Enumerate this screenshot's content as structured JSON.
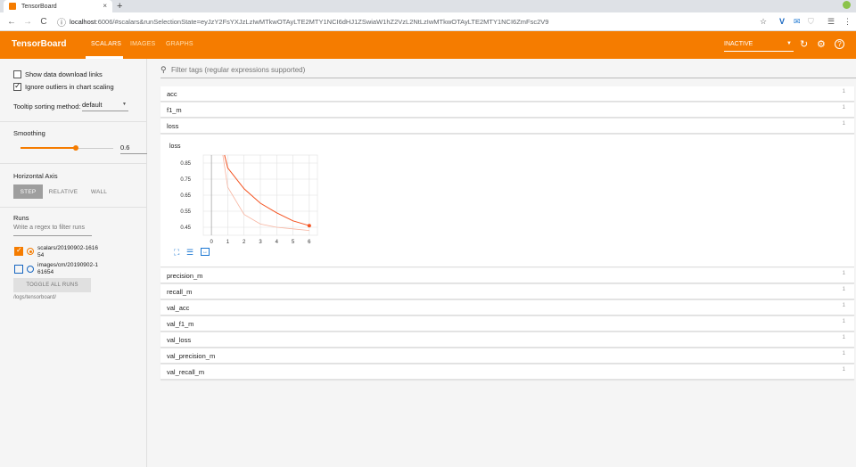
{
  "browser": {
    "tab_title": "TensorBoard",
    "tab_close": "×",
    "new_tab": "+",
    "url_host": "localhost",
    "url_rest": ":6006/#scalars&runSelectionState=eyJzY2FsYXJzLzIwMTkwOTAyLTE2MTY1NCI6dHJ1ZSwiaW1hZ2VzL2NtLzIwMTkwOTAyLTE2MTY1NCI6ZmFsc2V9",
    "back": "←",
    "forward": "→",
    "reload": "C",
    "info": "ⓘ",
    "star": "☆",
    "menu": "⋮"
  },
  "appbar": {
    "brand": "TensorBoard",
    "tabs": [
      {
        "label": "SCALARS",
        "active": true
      },
      {
        "label": "IMAGES",
        "active": false
      },
      {
        "label": "GRAPHS",
        "active": false
      }
    ],
    "status_select": "INACTIVE",
    "reload_icon": "↻",
    "settings_icon": "⚙",
    "help_icon": "?"
  },
  "sidebar": {
    "show_download": "Show data download links",
    "ignore_outliers": "Ignore outliers in chart scaling",
    "tooltip_label": "Tooltip sorting method:",
    "tooltip_value": "default",
    "smoothing_label": "Smoothing",
    "smoothing_value": "0.6",
    "smoothing_fraction": 0.6,
    "horizontal_axis_label": "Horizontal Axis",
    "axis_buttons": [
      "STEP",
      "RELATIVE",
      "WALL"
    ],
    "runs_label": "Runs",
    "regex_placeholder": "Write a regex to filter runs",
    "runs": [
      {
        "label": "scalars/20190902-161654",
        "checked": true,
        "color": "#f57c00"
      },
      {
        "label": "images/cm/20190902-161654",
        "checked": false,
        "color": "#1565c0"
      }
    ],
    "toggle_all": "TOGGLE ALL RUNS",
    "logdir": "/logs/tensorboard/"
  },
  "main": {
    "filter_placeholder": "Filter tags (regular expressions supported)",
    "tags_top": [
      {
        "name": "acc",
        "count": "1"
      },
      {
        "name": "f1_m",
        "count": "1"
      },
      {
        "name": "loss",
        "count": "1"
      }
    ],
    "tags_bottom": [
      {
        "name": "precision_m",
        "count": "1"
      },
      {
        "name": "recall_m",
        "count": "1"
      },
      {
        "name": "val_acc",
        "count": "1"
      },
      {
        "name": "val_f1_m",
        "count": "1"
      },
      {
        "name": "val_loss",
        "count": "1"
      },
      {
        "name": "val_precision_m",
        "count": "1"
      },
      {
        "name": "val_recall_m",
        "count": "1"
      }
    ]
  },
  "chart_data": {
    "type": "line",
    "title": "loss",
    "x_ticks": [
      0,
      1,
      2,
      3,
      4,
      5,
      6
    ],
    "y_ticks": [
      0.45,
      0.55,
      0.65,
      0.75,
      0.85
    ],
    "xlim": [
      -0.5,
      6.5
    ],
    "ylim": [
      0.4,
      0.9
    ],
    "series": [
      {
        "color": "#f4511e",
        "x": [
          0.8,
          1,
          2,
          3,
          4,
          5,
          6
        ],
        "y": [
          0.9,
          0.82,
          0.69,
          0.6,
          0.54,
          0.49,
          0.46
        ]
      },
      {
        "color": "#f7b4a0",
        "x": [
          0.7,
          1,
          2,
          3,
          4,
          5,
          6
        ],
        "y": [
          0.9,
          0.7,
          0.53,
          0.47,
          0.45,
          0.44,
          0.43
        ]
      }
    ]
  }
}
